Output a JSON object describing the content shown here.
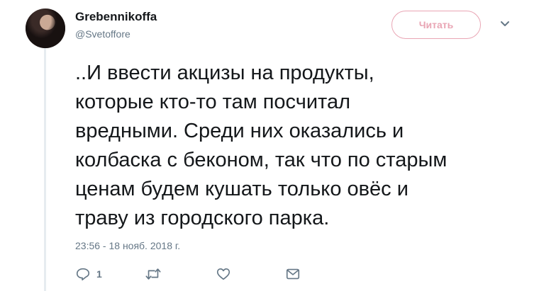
{
  "user": {
    "display_name": "Grebennikoffa",
    "handle": "@Svetoffore"
  },
  "follow_button": {
    "label": "Читать"
  },
  "tweet": {
    "text": "..И ввести акцизы на продукты,\nкоторые кто-то там посчитал\nвредными. Среди них оказались и\nколбаска с беконом, так что по старым\nценам будем кушать только овёс и\nтраву из городского парка.",
    "timestamp": "23:56 - 18 нояб. 2018 г."
  },
  "actions": {
    "reply_count": "1"
  },
  "icons": {
    "reply": "reply-icon",
    "retweet": "retweet-icon",
    "like": "heart-icon",
    "dm": "envelope-icon",
    "caret": "chevron-down-icon"
  },
  "colors": {
    "follow_accent": "#e9a5b4",
    "secondary_text": "#657786",
    "primary_text": "#14171a"
  }
}
